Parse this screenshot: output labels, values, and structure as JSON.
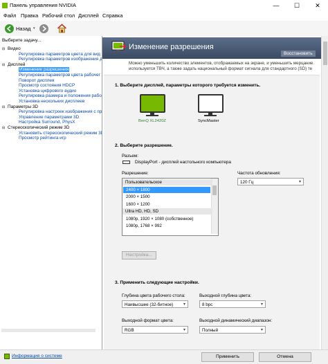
{
  "window": {
    "title": "Панель управления NVIDIA",
    "min": "—",
    "max": "☐",
    "close": "✕"
  },
  "menu": [
    "Файл",
    "Правка",
    "Рабочий стол",
    "Дисплей",
    "Справка"
  ],
  "toolbar": {
    "back_label": "Назад"
  },
  "left": {
    "header": "Выберите задачу...",
    "tree": [
      {
        "type": "cat",
        "text": "Видео"
      },
      {
        "type": "link",
        "text": "Регулировка параметров цвета для вид"
      },
      {
        "type": "link",
        "text": "Регулировка параметров изображения д"
      },
      {
        "type": "cat",
        "text": "Дисплей"
      },
      {
        "type": "sel",
        "text": "Изменение разрешения"
      },
      {
        "type": "link",
        "text": "Регулировка параметров цвета рабочег"
      },
      {
        "type": "link",
        "text": "Поворот дисплея"
      },
      {
        "type": "link",
        "text": "Просмотр состояния HDCP"
      },
      {
        "type": "link",
        "text": "Установка цифрового аудио"
      },
      {
        "type": "link",
        "text": "Регулировка размера и положения рабоч"
      },
      {
        "type": "link",
        "text": "Установка нескольких дисплеев"
      },
      {
        "type": "cat",
        "text": "Параметры 3D"
      },
      {
        "type": "link",
        "text": "Регулировка настроек изображения с пр"
      },
      {
        "type": "link",
        "text": "Управление параметрами 3D"
      },
      {
        "type": "link",
        "text": "Настройка Surround, PhysX"
      },
      {
        "type": "cat",
        "text": "Стереоскопический режим 3D"
      },
      {
        "type": "link",
        "text": "Установить стереоскопический режим 3D"
      },
      {
        "type": "link",
        "text": "Просмотр рейтинга игр"
      }
    ]
  },
  "main": {
    "title": "Изменение разрешения",
    "restore": "Восстановить",
    "desc1": "Можно уменьшить количество элементов, отображаемых на экране, и уменьшить мерцание.",
    "desc2": "используется ТВЧ, а также задать национальный формат сигнала для стандартного (SD) те",
    "step1": "1. Выберите дисплей, параметры которого требуется изменить.",
    "displays": [
      "BenQ XL2420Z",
      "SyncMaster"
    ],
    "step2": "2. Выберите разрешение.",
    "connector_label": "Разъем:",
    "connector_value": "DisplayPort - дисплей настольного компьютера",
    "resolution_label": "Разрешение:",
    "refresh_label": "Частота обновления:",
    "refresh_value": "120 Гц",
    "res_list": [
      {
        "t": "Пользовательское",
        "k": "hdr"
      },
      {
        "t": "2400 × 1800",
        "k": "sel"
      },
      {
        "t": "2000 × 1500",
        "k": ""
      },
      {
        "t": "1600 × 1200",
        "k": ""
      },
      {
        "t": "Ultra HD, HD, SD",
        "k": "hdr"
      },
      {
        "t": "1080p, 1920 × 1080 (собственное)",
        "k": ""
      },
      {
        "t": "1080p, 1768 × 992",
        "k": ""
      }
    ],
    "customize": "Настройка...",
    "step3": "3. Применить следующие настройки.",
    "desktop_depth_label": "Глубина цвета рабочего стола:",
    "desktop_depth_value": "Наивысшее (32-битное)",
    "output_depth_label": "Выходной глубина цвета:",
    "output_depth_value": "8 bpc",
    "color_format_label": "Выходной формат цвета:",
    "color_format_value": "RGB",
    "dyn_range_label": "Выходной динамический диапазон:",
    "dyn_range_value": "Полный"
  },
  "footer": {
    "info": "Информация о системе",
    "apply": "Применить",
    "cancel": "Отмена"
  }
}
